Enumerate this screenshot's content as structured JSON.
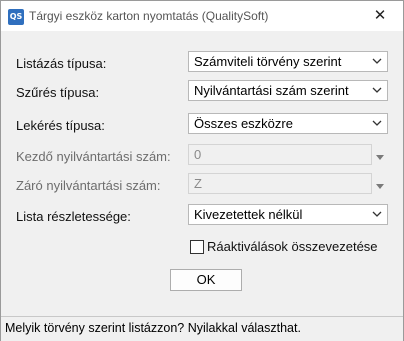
{
  "window": {
    "app_icon": "QS",
    "title": "Tárgyi eszköz karton nyomtatás (QualitySoft)",
    "close_glyph": "✕"
  },
  "form": {
    "listazas": {
      "label": "Listázás típusa:",
      "value": "Számviteli törvény szerint"
    },
    "szures": {
      "label": "Szűrés típusa:",
      "value": "Nyilvántartási szám szerint"
    },
    "lekeres": {
      "label": "Lekérés típusa:",
      "value": "Összes eszközre"
    },
    "kezdo": {
      "label": "Kezdő nyilvántartási szám:",
      "value": "0"
    },
    "zaro": {
      "label": "Záró nyilvántartási szám:",
      "value": "Z"
    },
    "reszletesseg": {
      "label": "Lista részletessége:",
      "value": "Kivezetettek nélkül"
    },
    "checkbox_label": "Ráaktiválások összevezetése",
    "checkbox_checked": false,
    "ok_label": "OK"
  },
  "statusbar": {
    "text": "Melyik törvény szerint listázzon? Nyilakkal választhat."
  },
  "colors": {
    "accent": "#2f6fbe",
    "client_bg": "#f0f0f0"
  },
  "icons": {
    "app": "app-logo-icon",
    "close": "close-icon",
    "dropdown": "chevron-down-icon"
  }
}
